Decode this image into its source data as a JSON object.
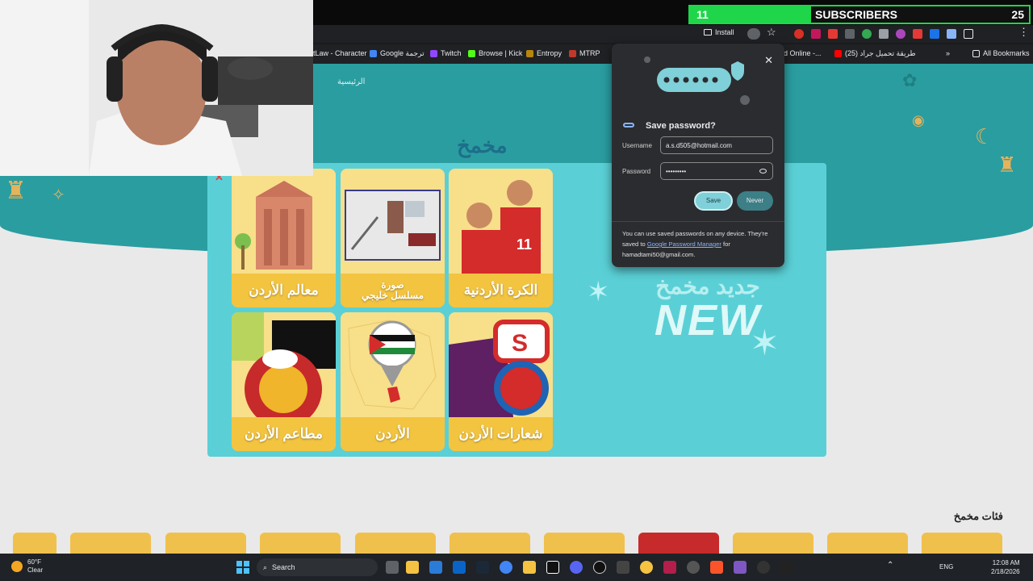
{
  "browser": {
    "install_label": "Install",
    "bookmarks": [
      {
        "label": "tLaw - Character",
        "color": "#888"
      },
      {
        "label": "Google ترجمة",
        "color": "#4285f4"
      },
      {
        "label": "Twitch",
        "color": "#9146ff"
      },
      {
        "label": "Browse | Kick",
        "color": "#53fc18"
      },
      {
        "label": "Entropy",
        "color": "#b8860b"
      },
      {
        "label": "MTRP",
        "color": "#c0392b"
      },
      {
        "label": "ad Online -...",
        "color": "#888"
      },
      {
        "label": "طريقة تحميل جراد (25)",
        "color": "#ff0000"
      }
    ],
    "all_bookmarks_label": "All Bookmarks"
  },
  "subscribers": {
    "current": "11",
    "label": "SUBSCRIBERS",
    "goal": "25"
  },
  "page": {
    "nav_home": "الرئيسية",
    "cards": [
      {
        "label": "معالم الأردن",
        "icon": "petra-icon"
      },
      {
        "label_line1": "صورة",
        "label_line2": "مسلسل خليجي",
        "icon": "room-photo-icon"
      },
      {
        "label": "الكرة الأردنية",
        "icon": "football-players-icon"
      },
      {
        "label": "مطاعم الأردن",
        "icon": "burger-restaurant-icon"
      },
      {
        "label": "الأردن",
        "icon": "jordan-map-icon"
      },
      {
        "label": "شعارات الأردن",
        "icon": "logos-icon"
      }
    ],
    "new_arabic": "جديد مخمخ",
    "new_word": "NEW",
    "categories_title": "فئات مخمخ"
  },
  "password_popup": {
    "title": "Save password?",
    "username_label": "Username",
    "username_value": "a.s.d505@hotmail.com",
    "password_label": "Password",
    "password_value": "•••••••••",
    "save_label": "Save",
    "never_label": "Never",
    "info_prefix": "You can use saved passwords on any device. They're saved to",
    "info_link": "Google Password Manager",
    "info_suffix": "for",
    "info_account": "hamadtami50@gmail.com."
  },
  "taskbar": {
    "weather_temp": "60°F",
    "weather_desc": "Clear",
    "search_label": "Search",
    "language": "ENG",
    "time": "12:08 AM",
    "date": "2/18/2026"
  },
  "colors": {
    "teal_header": "#2a9da0",
    "modal_bg": "#5ad0d6",
    "card_bg": "#f7d76f",
    "card_label": "#f3c440",
    "subscriber_green": "#1fd64a"
  }
}
